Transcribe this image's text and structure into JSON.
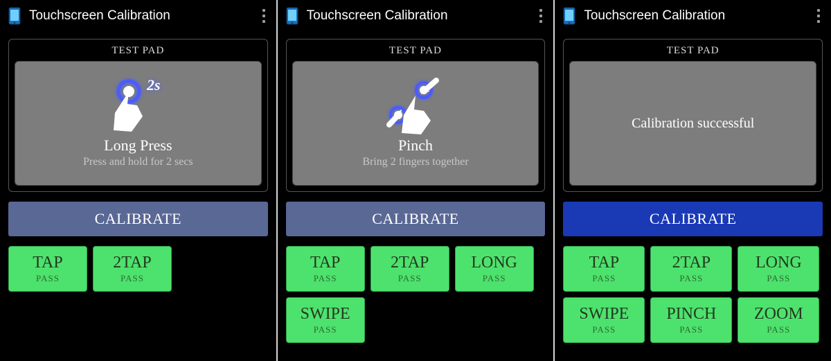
{
  "common": {
    "app_title": "Touchscreen Calibration",
    "testpad_label": "TEST PAD",
    "calibrate_label": "CALIBRATE",
    "icon_name": "phone-icon"
  },
  "panels": [
    {
      "testpad": {
        "icon": "longpress",
        "badge": "2s",
        "title": "Long Press",
        "subtitle": "Press and hold for 2 secs",
        "message": null
      },
      "calibrate_style": "soft",
      "tiles": [
        {
          "label": "TAP",
          "status": "PASS"
        },
        {
          "label": "2TAP",
          "status": "PASS"
        }
      ]
    },
    {
      "testpad": {
        "icon": "pinch",
        "badge": null,
        "title": "Pinch",
        "subtitle": "Bring 2 fingers together",
        "message": null
      },
      "calibrate_style": "soft",
      "tiles": [
        {
          "label": "TAP",
          "status": "PASS"
        },
        {
          "label": "2TAP",
          "status": "PASS"
        },
        {
          "label": "LONG",
          "status": "PASS"
        },
        {
          "label": "SWIPE",
          "status": "PASS"
        }
      ]
    },
    {
      "testpad": {
        "icon": null,
        "badge": null,
        "title": null,
        "subtitle": null,
        "message": "Calibration successful"
      },
      "calibrate_style": "vivid",
      "tiles": [
        {
          "label": "TAP",
          "status": "PASS"
        },
        {
          "label": "2TAP",
          "status": "PASS"
        },
        {
          "label": "LONG",
          "status": "PASS"
        },
        {
          "label": "SWIPE",
          "status": "PASS"
        },
        {
          "label": "PINCH",
          "status": "PASS"
        },
        {
          "label": "ZOOM",
          "status": "PASS"
        }
      ]
    }
  ]
}
